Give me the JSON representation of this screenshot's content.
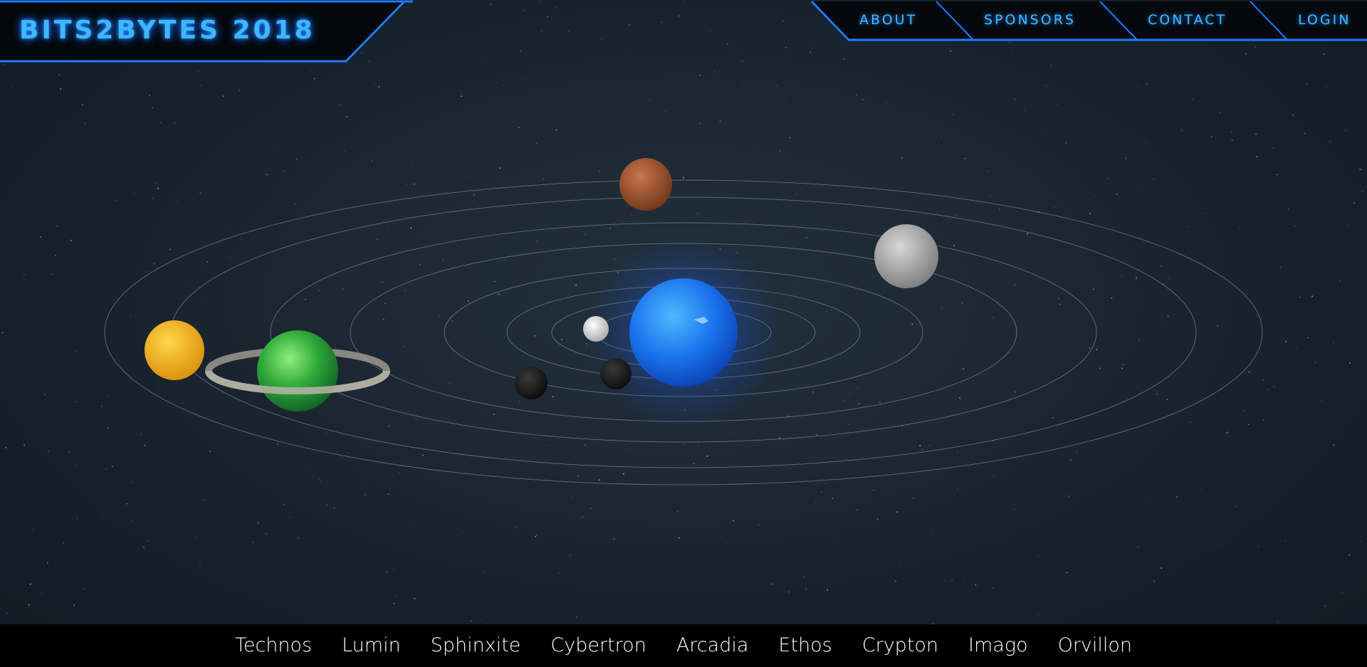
{
  "header": {
    "logo": "BITS2BYTES 2018"
  },
  "nav": {
    "items": [
      "ABOUT",
      "SPONSORS",
      "CONTACT",
      "LOGIN"
    ]
  },
  "planets": {
    "names": [
      "Technos",
      "Lumin",
      "Sphinxite",
      "Cybertron",
      "Arcadia",
      "Ethos",
      "Crypton",
      "Imago",
      "Orvillon"
    ]
  },
  "colors": {
    "accent": "#3fb6ff",
    "nav_border": "#1e7bff",
    "bottom_bar": "#000000",
    "background": "#1a2530",
    "star_core": "#1a7cff"
  }
}
